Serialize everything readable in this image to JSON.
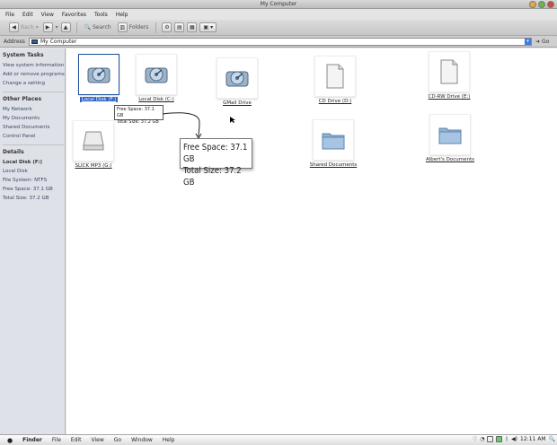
{
  "window": {
    "title": "My Computer"
  },
  "menubar": [
    "File",
    "Edit",
    "View",
    "Favorites",
    "Tools",
    "Help"
  ],
  "toolbar": {
    "back": "Back",
    "search": "Search",
    "folders": "Folders"
  },
  "address": {
    "label": "Address",
    "value": "My Computer",
    "go": "Go"
  },
  "sidebar": {
    "tasks_title": "System Tasks",
    "tasks": [
      "View system information",
      "Add or remove programs",
      "Change a setting"
    ],
    "places_title": "Other Places",
    "places": [
      "My Network",
      "My Documents",
      "Shared Documents",
      "Control Panel"
    ],
    "details_title": "Details",
    "details": [
      "Local Disk (F:)",
      "Local Disk",
      "File System: NTFS",
      "Free Space: 37.1 GB",
      "Total Size: 37.2 GB"
    ]
  },
  "items": [
    {
      "label": "Local Disk (F:)",
      "kind": "hard-drive-icon"
    },
    {
      "label": "Local Disk (C:)",
      "kind": "hard-drive-icon"
    },
    {
      "label": "GMail Drive",
      "kind": "hard-drive-icon"
    },
    {
      "label": "CD Drive (D:)",
      "kind": "document-icon"
    },
    {
      "label": "CD-RW Drive (E:)",
      "kind": "document-icon"
    },
    {
      "label": "SLICK MP3 (G:)",
      "kind": "removable-drive-icon"
    },
    {
      "label": "Shared Documents",
      "kind": "folder-icon"
    },
    {
      "label": "Albert's Documents",
      "kind": "folder-icon"
    }
  ],
  "tooltip": {
    "free": "Free Space: 37.1 GB",
    "total": "Total Size: 37.2 GB"
  },
  "bottombar": {
    "menus": [
      "Finder",
      "File",
      "Edit",
      "View",
      "Go",
      "Window",
      "Help"
    ],
    "clock": "12:11 AM"
  }
}
